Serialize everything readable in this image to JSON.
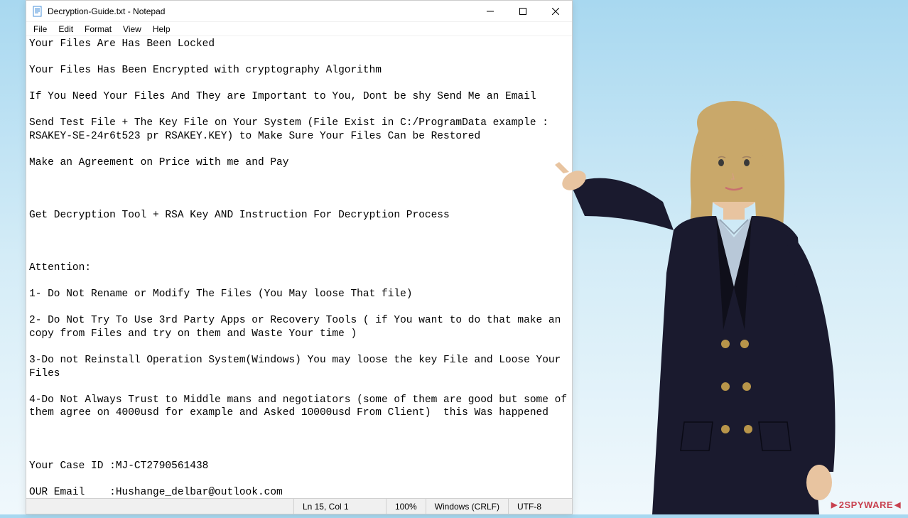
{
  "window": {
    "title": "Decryption-Guide.txt - Notepad"
  },
  "menu": {
    "file": "File",
    "edit": "Edit",
    "format": "Format",
    "view": "View",
    "help": "Help"
  },
  "content": "Your Files Are Has Been Locked\n\nYour Files Has Been Encrypted with cryptography Algorithm\n\nIf You Need Your Files And They are Important to You, Dont be shy Send Me an Email\n\nSend Test File + The Key File on Your System (File Exist in C:/ProgramData example : RSAKEY-SE-24r6t523 pr RSAKEY.KEY) to Make Sure Your Files Can be Restored\n\nMake an Agreement on Price with me and Pay\n\n\n\nGet Decryption Tool + RSA Key AND Instruction For Decryption Process\n\n\n\nAttention:\n\n1- Do Not Rename or Modify The Files (You May loose That file)\n\n2- Do Not Try To Use 3rd Party Apps or Recovery Tools ( if You want to do that make an copy from Files and try on them and Waste Your time )\n\n3-Do not Reinstall Operation System(Windows) You may loose the key File and Loose Your Files\n\n4-Do Not Always Trust to Middle mans and negotiators (some of them are good but some of them agree on 4000usd for example and Asked 10000usd From Client)  this Was happened\n\n\n\nYour Case ID :MJ-CT2790561438\n\nOUR Email    :Hushange_delbar@outlook.com",
  "statusbar": {
    "position": "Ln 15, Col 1",
    "zoom": "100%",
    "lineending": "Windows (CRLF)",
    "encoding": "UTF-8"
  },
  "watermark": {
    "text": "2SPYWARE"
  }
}
